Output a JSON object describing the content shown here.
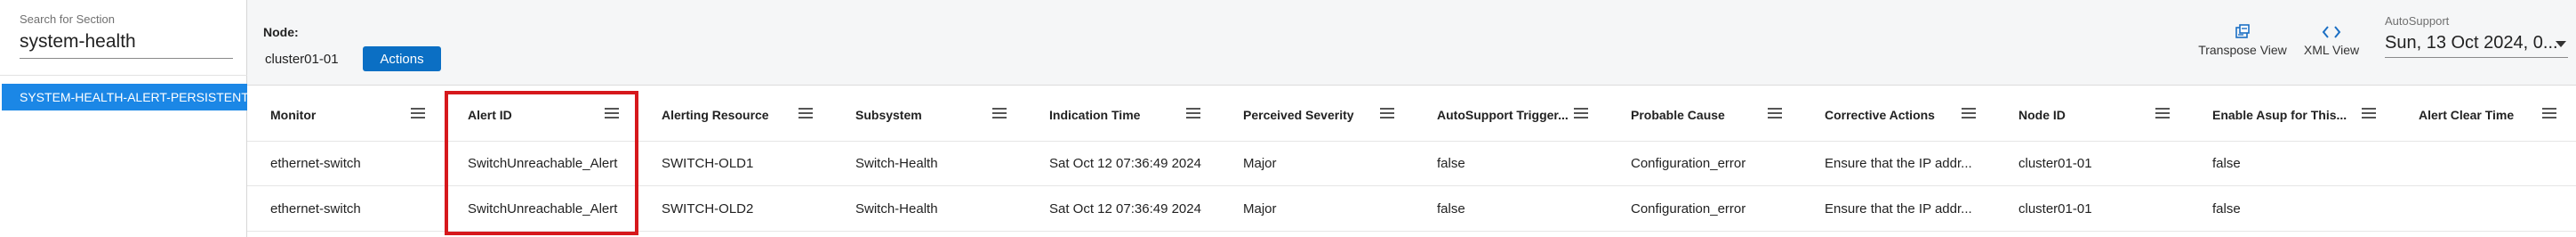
{
  "search": {
    "label": "Search for Section",
    "value": "system-health"
  },
  "sections": [
    {
      "label": "SYSTEM-HEALTH-ALERT-PERSISTENT.XML"
    }
  ],
  "node": {
    "label": "Node:",
    "value": "cluster01-01"
  },
  "toolbar": {
    "actions_label": "Actions",
    "transpose_label": "Transpose View",
    "xml_label": "XML View",
    "autosupport_label": "AutoSupport",
    "autosupport_value": "Sun, 13 Oct 2024, 0..."
  },
  "table": {
    "columns": [
      "Monitor",
      "Alert ID",
      "Alerting Resource",
      "Subsystem",
      "Indication Time",
      "Perceived Severity",
      "AutoSupport Trigger...",
      "Probable Cause",
      "Corrective Actions",
      "Node ID",
      "Enable Asup for This...",
      "Alert Clear Time"
    ],
    "rows": [
      [
        "ethernet-switch",
        "SwitchUnreachable_Alert",
        "SWITCH-OLD1",
        "Switch-Health",
        "Sat Oct 12 07:36:49 2024",
        "Major",
        "false",
        "Configuration_error",
        "Ensure that the IP addr...",
        "cluster01-01",
        "false",
        ""
      ],
      [
        "ethernet-switch",
        "SwitchUnreachable_Alert",
        "SWITCH-OLD2",
        "Switch-Health",
        "Sat Oct 12 07:36:49 2024",
        "Major",
        "false",
        "Configuration_error",
        "Ensure that the IP addr...",
        "cluster01-01",
        "false",
        ""
      ]
    ]
  },
  "colors": {
    "accent": "#1b87e6",
    "button": "#0b6fc4",
    "highlight": "#d6181c"
  }
}
